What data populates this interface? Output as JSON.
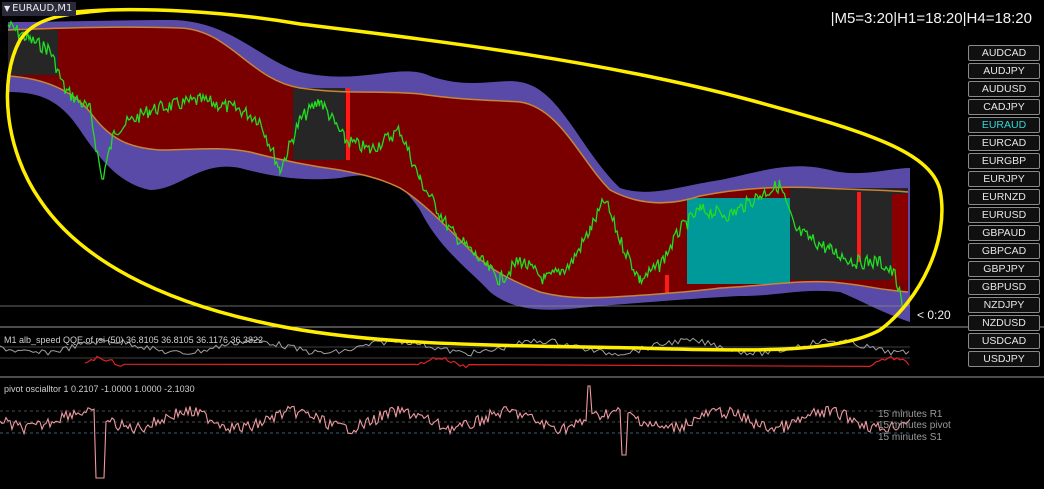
{
  "chart": {
    "title": "EURAUD,M1",
    "timeframes": "|M5=3:20|H1=18:20|H4=18:20",
    "countdown": "< 0:20"
  },
  "symbols": [
    {
      "label": "AUDCAD",
      "active": false
    },
    {
      "label": "AUDJPY",
      "active": false
    },
    {
      "label": "AUDUSD",
      "active": false
    },
    {
      "label": "CADJPY",
      "active": false
    },
    {
      "label": "EURAUD",
      "active": true
    },
    {
      "label": "EURCAD",
      "active": false
    },
    {
      "label": "EURGBP",
      "active": false
    },
    {
      "label": "EURJPY",
      "active": false
    },
    {
      "label": "EURNZD",
      "active": false
    },
    {
      "label": "EURUSD",
      "active": false
    },
    {
      "label": "GBPAUD",
      "active": false
    },
    {
      "label": "GBPCAD",
      "active": false
    },
    {
      "label": "GBPJPY",
      "active": false
    },
    {
      "label": "GBPUSD",
      "active": false
    },
    {
      "label": "NZDJPY",
      "active": false
    },
    {
      "label": "NZDUSD",
      "active": false
    },
    {
      "label": "USDCAD",
      "active": false
    },
    {
      "label": "USDJPY",
      "active": false
    }
  ],
  "indicators": {
    "qqe_label": "M1 alb_speed QQE of rsi (50) 36.8105 36.8105 36.1176 36.3822",
    "pivot_label": "pivot oscialltor 1 0.2107 -1.0000 1.0000 -2.1030",
    "pivot_r1": "15 minutes R1",
    "pivot_pivot": "15 minutes pivot",
    "pivot_s1": "15 minutes S1"
  },
  "colors": {
    "background": "#000000",
    "price_line": "#22dd22",
    "channel_up": "#7a0000",
    "channel_flat": "#262626",
    "channel_bull": "#009999",
    "volatility_band": "#5a4aa8",
    "band_line": "#c8843a",
    "marker": "#ff1a1a",
    "annotation": "#ffee00",
    "qqe_line": "#a0a0a0",
    "qqe_neg": "#dd2222",
    "pivot_line": "#ee9aa0",
    "active_symbol": "#2fd7d7"
  }
}
